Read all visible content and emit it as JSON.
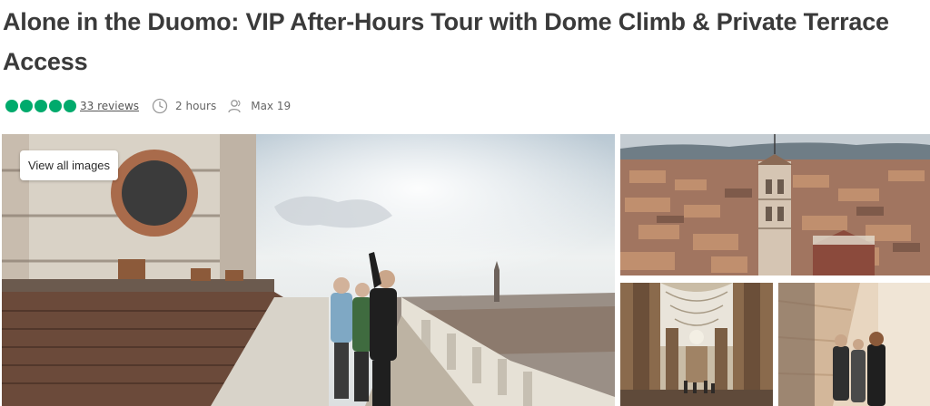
{
  "listing": {
    "title": "Alone in the Duomo: VIP After-Hours Tour with Dome Climb & Private Terrace Access",
    "rating": 5,
    "reviews_label": "33 reviews",
    "duration": "2 hours",
    "group_size": "Max 19",
    "rating_color": "#00aa6c"
  },
  "gallery": {
    "view_all_label": "View all images",
    "images": [
      {
        "name": "main-terrace-photo",
        "icon": "photo"
      },
      {
        "name": "florence-rooftops-photo",
        "icon": "photo"
      },
      {
        "name": "cathedral-nave-photo",
        "icon": "photo"
      },
      {
        "name": "dome-corridor-photo",
        "icon": "photo"
      }
    ]
  }
}
